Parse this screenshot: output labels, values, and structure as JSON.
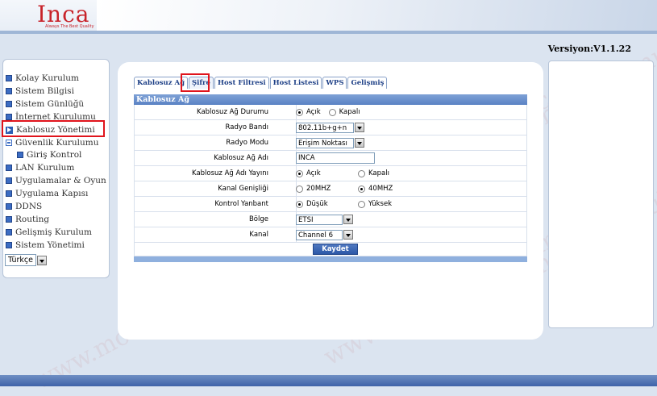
{
  "header": {
    "logo": "Inca",
    "logo_tagline": "Always The Best Quality"
  },
  "version": "Versiyon:V1.1.22",
  "sidebar": {
    "items": [
      {
        "label": "Kolay Kurulum"
      },
      {
        "label": "Sistem Bilgisi"
      },
      {
        "label": "Sistem Günlüğü"
      },
      {
        "label": "İnternet Kurulumu"
      },
      {
        "label": "Kablosuz Yönetimi"
      },
      {
        "label": "Güvenlik Kurulumu"
      },
      {
        "label": "Giriş Kontrol"
      },
      {
        "label": "LAN Kurulum"
      },
      {
        "label": "Uygulamalar & Oyun"
      },
      {
        "label": "Uygulama Kapısı"
      },
      {
        "label": "DDNS"
      },
      {
        "label": "Routing"
      },
      {
        "label": "Gelişmiş Kurulum"
      },
      {
        "label": "Sistem Yönetimi"
      }
    ],
    "language": "Türkçe"
  },
  "tabs": [
    "Kablosuz Ağ",
    "Şifre",
    "Host Filtresi",
    "Host Listesi",
    "WPS",
    "Gelişmiş"
  ],
  "form": {
    "title": "Kablosuz Ağ",
    "status_label": "Kablosuz Ağ Durumu",
    "status_on": "Açık",
    "status_off": "Kapalı",
    "band_label": "Radyo Bandı",
    "band_value": "802.11b+g+n",
    "mode_label": "Radyo Modu",
    "mode_value": "Erişim Noktası",
    "ssid_label": "Kablosuz Ağ Adı",
    "ssid_value": "INCA",
    "broadcast_label": "Kablosuz Ağ Adı Yayını",
    "broadcast_on": "Açık",
    "broadcast_off": "Kapalı",
    "width_label": "Kanal Genişliği",
    "width_20": "20MHZ",
    "width_40": "40MHZ",
    "sideband_label": "Kontrol Yanbant",
    "sideband_low": "Düşük",
    "sideband_high": "Yüksek",
    "region_label": "Bölge",
    "region_value": "ETSI",
    "channel_label": "Kanal",
    "channel_value": "Channel 6",
    "save": "Kaydet"
  },
  "watermark": "www.modemkurulumu.com",
  "colors": {
    "accent": "#2c58a8",
    "highlight": "#e0141c",
    "logo": "#c8232a"
  }
}
